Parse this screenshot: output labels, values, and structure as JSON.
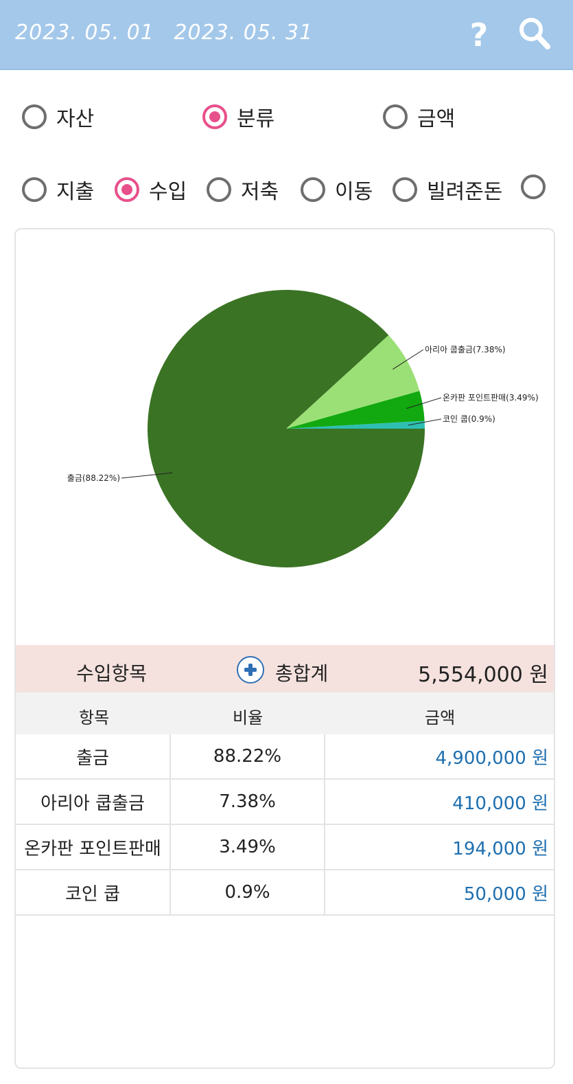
{
  "header": {
    "start_date": "2023. 05. 01",
    "end_date": "2023. 05. 31",
    "help_icon": "question-mark-icon",
    "search_icon": "magnifier-icon"
  },
  "view_mode": {
    "options": [
      "자산",
      "분류",
      "금액"
    ],
    "selected": "분류"
  },
  "type_filter": {
    "options": [
      "지출",
      "수입",
      "저축",
      "이동",
      "빌려준돈"
    ],
    "selected": "수입"
  },
  "chart_data": {
    "type": "pie",
    "slices": [
      {
        "label": "출금(88.22%)",
        "value": 88.22,
        "color": "#3b7324"
      },
      {
        "label": "아리아 쿱출금(7.38%)",
        "value": 7.38,
        "color": "#9be076"
      },
      {
        "label": "온카판 포인트판매(3.49%)",
        "value": 3.49,
        "color": "#12a80f"
      },
      {
        "label": "코인 쿱(0.9%)",
        "value": 0.9,
        "color": "#2ebfb3"
      }
    ]
  },
  "summary": {
    "title": "수입항목",
    "total_label": "총합계",
    "total_value": "5,554,000 원"
  },
  "table": {
    "headers": [
      "항목",
      "비율",
      "금액"
    ],
    "rows": [
      {
        "item": "출금",
        "ratio": "88.22%",
        "amount": "4,900,000 원"
      },
      {
        "item": "아리아 쿱출금",
        "ratio": "7.38%",
        "amount": "410,000 원"
      },
      {
        "item": "온카판 포인트판매",
        "ratio": "3.49%",
        "amount": "194,000 원"
      },
      {
        "item": "코인 쿱",
        "ratio": "0.9%",
        "amount": "50,000 원"
      }
    ]
  },
  "colors": {
    "header_bg": "#a4c8ea",
    "accent": "#e8508b",
    "amount_text": "#1e6fb0",
    "summary_bg": "#f5e2de"
  }
}
